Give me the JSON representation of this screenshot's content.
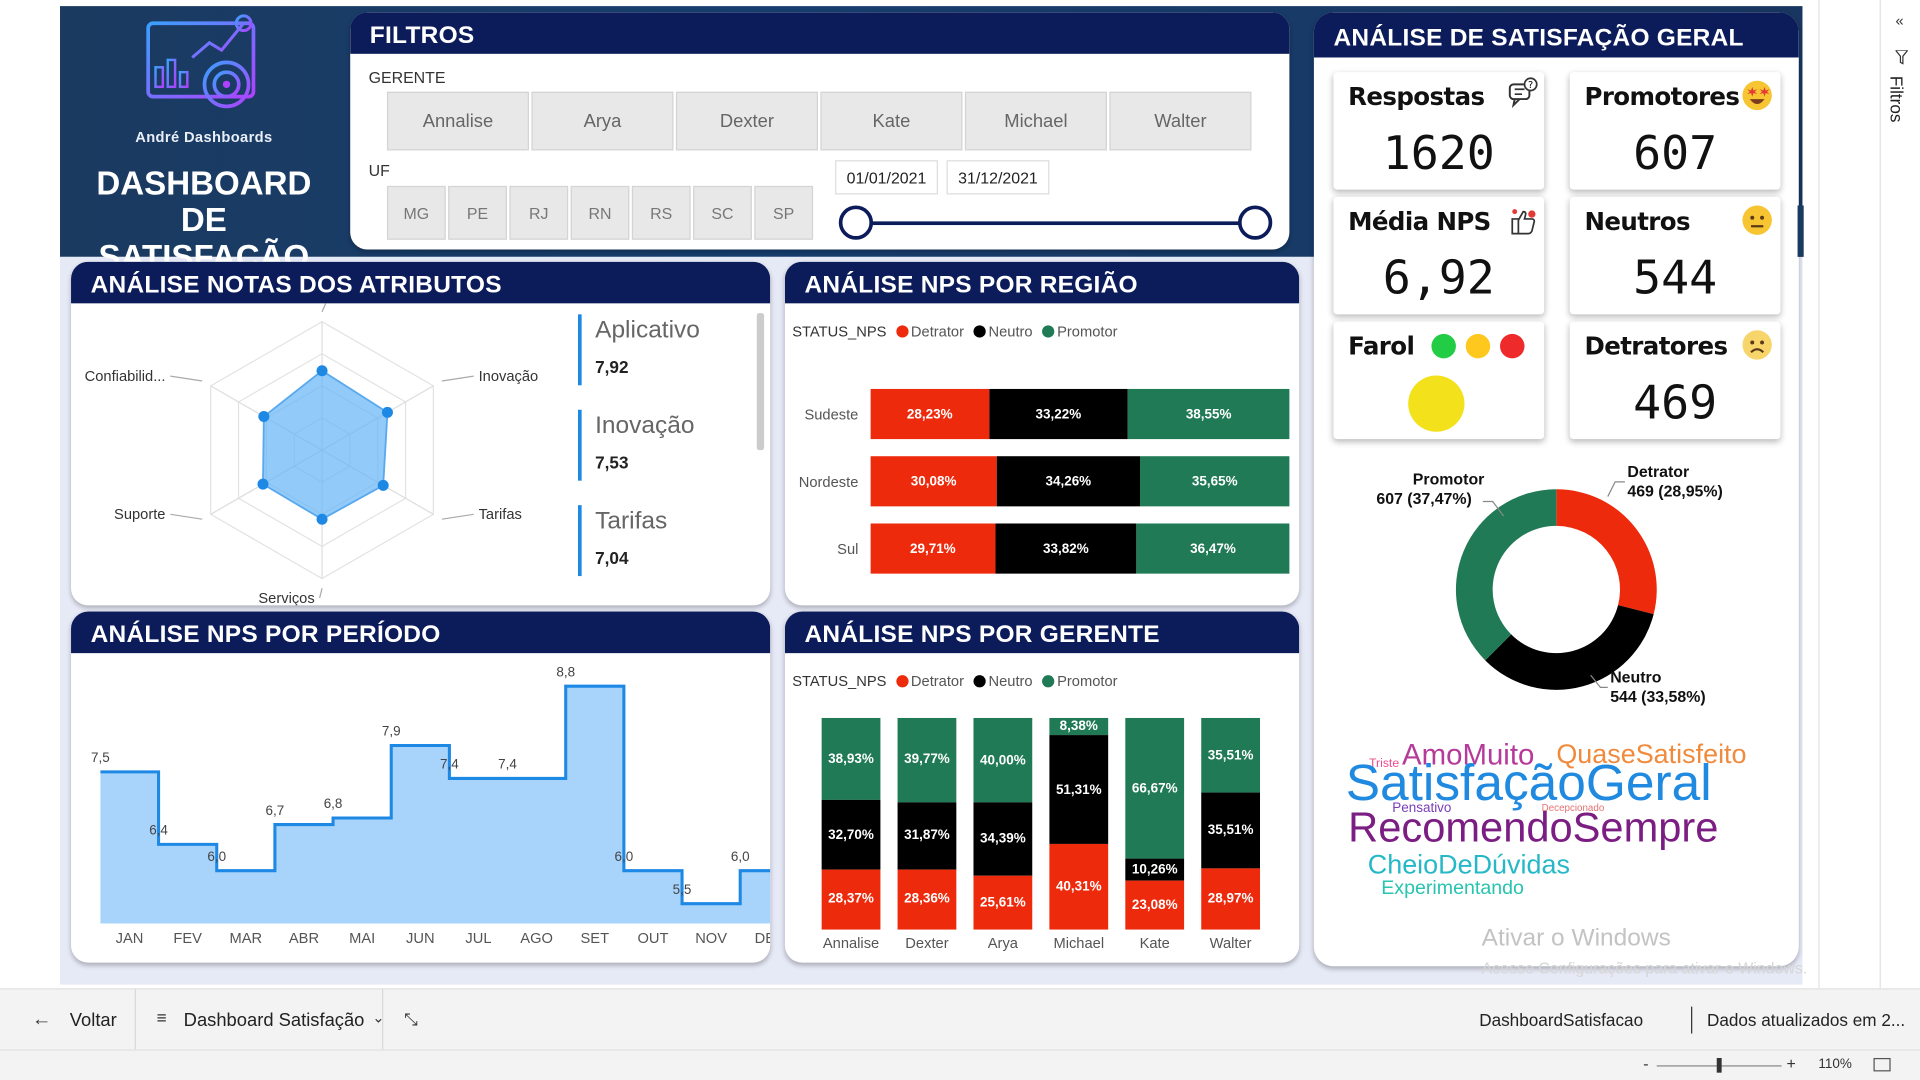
{
  "brand": {
    "company": "André Dashboards",
    "title_line1": "DASHBOARD",
    "title_line2": "DE SATISFAÇÃO"
  },
  "filters": {
    "title": "FILTROS",
    "manager_label": "GERENTE",
    "managers": [
      "Annalise",
      "Arya",
      "Dexter",
      "Kate",
      "Michael",
      "Walter"
    ],
    "uf_label": "UF",
    "ufs": [
      "MG",
      "PE",
      "RJ",
      "RN",
      "RS",
      "SC",
      "SP"
    ],
    "date_start": "01/01/2021",
    "date_end": "31/12/2021"
  },
  "attributes": {
    "title": "ANÁLISE NOTAS DOS ATRIBUTOS",
    "radar_labels": [
      "Aplicativo",
      "Inovação",
      "Tarifas",
      "Serviços",
      "Suporte",
      "Confiabilid..."
    ],
    "radar_values": [
      7.92,
      7.53,
      7.04,
      6.9,
      6.8,
      6.7
    ],
    "cards": [
      {
        "name": "Aplicativo",
        "value": "7,92"
      },
      {
        "name": "Inovação",
        "value": "7,53"
      },
      {
        "name": "Tarifas",
        "value": "7,04"
      }
    ]
  },
  "region": {
    "title": "ANÁLISE NPS POR REGIÃO",
    "legend_title": "STATUS_NPS",
    "legend": [
      "Detrator",
      "Neutro",
      "Promotor"
    ],
    "rows": [
      {
        "name": "Sudeste",
        "detrator": 28.23,
        "neutro": 33.22,
        "promotor": 38.55,
        "labels": [
          "28,23%",
          "33,22%",
          "38,55%"
        ]
      },
      {
        "name": "Nordeste",
        "detrator": 30.08,
        "neutro": 34.26,
        "promotor": 35.65,
        "labels": [
          "30,08%",
          "34,26%",
          "35,65%"
        ]
      },
      {
        "name": "Sul",
        "detrator": 29.71,
        "neutro": 33.82,
        "promotor": 36.47,
        "labels": [
          "29,71%",
          "33,82%",
          "36,47%"
        ]
      }
    ]
  },
  "period": {
    "title": "ANÁLISE NPS POR PERÍODO",
    "months": [
      "JAN",
      "FEV",
      "MAR",
      "ABR",
      "MAI",
      "JUN",
      "JUL",
      "AGO",
      "SET",
      "OUT",
      "NOV",
      "DEZ"
    ],
    "values": [
      7.5,
      6.4,
      6.0,
      6.7,
      6.8,
      7.9,
      7.4,
      7.4,
      8.8,
      6.0,
      5.5,
      6.0
    ],
    "labels": [
      "7,5",
      "6,4",
      "6,0",
      "6,7",
      "6,8",
      "7,9",
      "7,4",
      "7,4",
      "8,8",
      "6,0",
      "5,5",
      "6,0"
    ]
  },
  "manager_chart": {
    "title": "ANÁLISE NPS POR GERENTE",
    "legend_title": "STATUS_NPS",
    "legend": [
      "Detrator",
      "Neutro",
      "Promotor"
    ],
    "bars": [
      {
        "name": "Annalise",
        "detrator": 28.37,
        "neutro": 32.7,
        "promotor": 38.93,
        "labels": [
          "28,37%",
          "32,70%",
          "38,93%"
        ]
      },
      {
        "name": "Dexter",
        "detrator": 28.36,
        "neutro": 31.87,
        "promotor": 39.77,
        "labels": [
          "28,36%",
          "31,87%",
          "39,77%"
        ]
      },
      {
        "name": "Arya",
        "detrator": 25.61,
        "neutro": 34.39,
        "promotor": 40.0,
        "labels": [
          "25,61%",
          "34,39%",
          "40,00%"
        ]
      },
      {
        "name": "Michael",
        "detrator": 40.31,
        "neutro": 51.31,
        "promotor": 8.38,
        "labels": [
          "40,31%",
          "51,31%",
          "8,38%"
        ]
      },
      {
        "name": "Kate",
        "detrator": 23.08,
        "neutro": 10.26,
        "promotor": 66.67,
        "labels": [
          "23,08%",
          "10,26%",
          "66,67%"
        ]
      },
      {
        "name": "Walter",
        "detrator": 28.97,
        "neutro": 35.51,
        "promotor": 35.51,
        "labels": [
          "28,97%",
          "35,51%",
          "35,51%"
        ]
      }
    ]
  },
  "general": {
    "title": "ANÁLISE DE SATISFAÇÃO GERAL",
    "respostas_label": "Respostas",
    "respostas_value": "1620",
    "promotores_label": "Promotores",
    "promotores_value": "607",
    "media_label": "Média NPS",
    "media_value": "6,92",
    "neutros_label": "Neutros",
    "neutros_value": "544",
    "farol_label": "Farol",
    "detratores_label": "Detratores",
    "detratores_value": "469",
    "donut": {
      "promotor_name": "Promotor",
      "promotor_text": "607 (37,47%)",
      "promotor": 37.47,
      "detrator_name": "Detrator",
      "detrator_text": "469 (28,95%)",
      "detrator": 28.95,
      "neutro_name": "Neutro",
      "neutro_text": "544 (33,58%)",
      "neutro": 33.58
    },
    "words": [
      "AmoMuito",
      "QuaseSatisfeito",
      "Triste",
      "SatisfaçãoGeral",
      "Pensativo",
      "Decepcionado",
      "RecomendoSempre",
      "CheioDeDúvidas",
      "Experimentando"
    ]
  },
  "watermark": {
    "line1": "Ativar o Windows",
    "line2": "Acesse Configurações para ativar o Windows."
  },
  "right_pane": {
    "label": "Filtros"
  },
  "taskbar": {
    "back": "Voltar",
    "page": "Dashboard Satisfação",
    "report": "DashboardSatisfacao",
    "updated": "Dados atualizados em 2..."
  },
  "status": {
    "zoom": "110%"
  },
  "colors": {
    "detrator": "#ee2a0c",
    "neutro": "#000000",
    "promotor": "#207a55",
    "navy": "#0c1c5a",
    "area": "#a8d4fb",
    "line": "#1e88e5"
  }
}
